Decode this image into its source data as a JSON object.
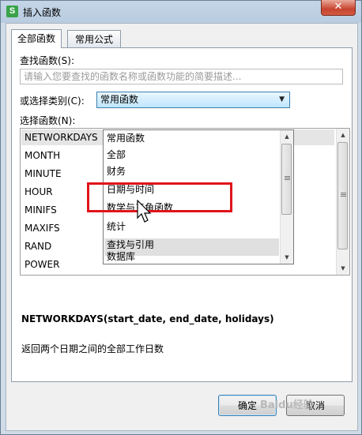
{
  "window": {
    "title": "插入函数",
    "app_icon_letter": "S",
    "close_glyph": "✕"
  },
  "tabs": [
    {
      "label": "全部函数",
      "active": true
    },
    {
      "label": "常用公式",
      "active": false
    }
  ],
  "search": {
    "label": "查找函数(S):",
    "placeholder": "请输入您要查找的函数名称或函数功能的简要描述..."
  },
  "category": {
    "label": "或选择类别(C):",
    "selected": "常用函数"
  },
  "functions_label": "选择函数(N):",
  "functions": [
    "NETWORKDAYS",
    "MONTH",
    "MINUTE",
    "HOUR",
    "MINIFS",
    "MAXIFS",
    "RAND",
    "POWER"
  ],
  "selected_function": "NETWORKDAYS",
  "dropdown_options": [
    "常用函数",
    "全部",
    "财务",
    "日期与时间",
    "数学与三角函数",
    "统计",
    "查找与引用",
    "数据库"
  ],
  "hovered_option": "统计",
  "signature": "NETWORKDAYS(start_date, end_date, holidays)",
  "description": "返回两个日期之间的全部工作日数",
  "buttons": {
    "ok": "确定",
    "cancel": "取消"
  },
  "watermark": "Baidu经验",
  "colors": {
    "highlight_box": "#e1141b",
    "app_icon": "#3aa34a",
    "close_button": "#c7442f"
  }
}
